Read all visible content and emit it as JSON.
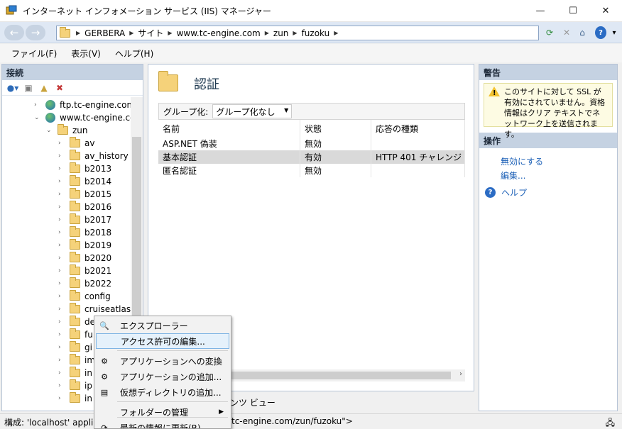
{
  "window": {
    "title": "インターネット インフォメーション サービス (IIS) マネージャー",
    "minimize": "—",
    "maximize": "☐",
    "close": "✕"
  },
  "nav": {
    "back": "←",
    "forward": "→",
    "breadcrumb": [
      "GERBERA",
      "サイト",
      "www.tc-engine.com",
      "zun",
      "fuzoku"
    ],
    "help_dropdown": "▾"
  },
  "menu": [
    "ファイル(F)",
    "表示(V)",
    "ヘルプ(H)"
  ],
  "connections": {
    "header": "接続",
    "tree": [
      {
        "label": "ftp.tc-engine.com",
        "type": "site",
        "chev": "›",
        "indent": 1
      },
      {
        "label": "www.tc-engine.cor",
        "type": "site",
        "chev": "⌄",
        "indent": 1
      },
      {
        "label": "zun",
        "type": "folder",
        "chev": "⌄",
        "indent": 2
      },
      {
        "label": "av",
        "type": "folder",
        "chev": "›",
        "indent": 3
      },
      {
        "label": "av_history",
        "type": "folder",
        "chev": "›",
        "indent": 3
      },
      {
        "label": "b2013",
        "type": "folder",
        "chev": "›",
        "indent": 3
      },
      {
        "label": "b2014",
        "type": "folder",
        "chev": "›",
        "indent": 3
      },
      {
        "label": "b2015",
        "type": "folder",
        "chev": "›",
        "indent": 3
      },
      {
        "label": "b2016",
        "type": "folder",
        "chev": "›",
        "indent": 3
      },
      {
        "label": "b2017",
        "type": "folder",
        "chev": "›",
        "indent": 3
      },
      {
        "label": "b2018",
        "type": "folder",
        "chev": "›",
        "indent": 3
      },
      {
        "label": "b2019",
        "type": "folder",
        "chev": "›",
        "indent": 3
      },
      {
        "label": "b2020",
        "type": "folder",
        "chev": "›",
        "indent": 3
      },
      {
        "label": "b2021",
        "type": "folder",
        "chev": "›",
        "indent": 3
      },
      {
        "label": "b2022",
        "type": "folder",
        "chev": "›",
        "indent": 3
      },
      {
        "label": "config",
        "type": "folder",
        "chev": "›",
        "indent": 3
      },
      {
        "label": "cruiseatlas",
        "type": "folder",
        "chev": "›",
        "indent": 3
      },
      {
        "label": "de",
        "type": "folder",
        "chev": "›",
        "indent": 3
      },
      {
        "label": "fu",
        "type": "folder",
        "chev": "›",
        "indent": 3
      },
      {
        "label": "gi",
        "type": "folder",
        "chev": "›",
        "indent": 3
      },
      {
        "label": "im",
        "type": "folder",
        "chev": "›",
        "indent": 3
      },
      {
        "label": "in",
        "type": "folder",
        "chev": "›",
        "indent": 3
      },
      {
        "label": "ip",
        "type": "folder",
        "chev": "›",
        "indent": 3
      },
      {
        "label": "in",
        "type": "folder",
        "chev": "›",
        "indent": 3
      }
    ]
  },
  "feature": {
    "title": "認証",
    "group_label": "グループ化:",
    "group_value": "グループ化なし",
    "columns": [
      "名前",
      "状態",
      "応答の種類"
    ],
    "rows": [
      {
        "name": "ASP.NET 偽装",
        "state": "無効",
        "response": "",
        "selected": false
      },
      {
        "name": "基本認証",
        "state": "有効",
        "response": "HTTP 401 チャレンジ",
        "selected": true
      },
      {
        "name": "匿名認証",
        "state": "無効",
        "response": "",
        "selected": false
      }
    ],
    "view_tab": "テンツ ビュー"
  },
  "alerts": {
    "header": "警告",
    "message": "このサイトに対して SSL が有効にされていません。資格情報はクリア テキストでネットワーク上を送信されます。"
  },
  "actions": {
    "header": "操作",
    "disable": "無効にする",
    "edit": "編集...",
    "help": "ヘルプ"
  },
  "status": {
    "left": "構成: 'localhost' applica",
    "right": "tc-engine.com/zun/fuzoku\">"
  },
  "context_menu": {
    "items": [
      {
        "label": "エクスプローラー",
        "icon": "explore-icon"
      },
      {
        "label": "アクセス許可の編集...",
        "icon": "",
        "highlighted": true
      },
      {
        "label": "アプリケーションへの変換",
        "icon": "app-convert-icon"
      },
      {
        "label": "アプリケーションの追加...",
        "icon": "app-add-icon"
      },
      {
        "label": "仮想ディレクトリの追加...",
        "icon": "vdir-add-icon"
      },
      {
        "label": "フォルダーの管理",
        "icon": "",
        "submenu": "▶"
      },
      {
        "label": "最新の情報に更新(R)",
        "icon": "refresh-icon"
      }
    ]
  }
}
